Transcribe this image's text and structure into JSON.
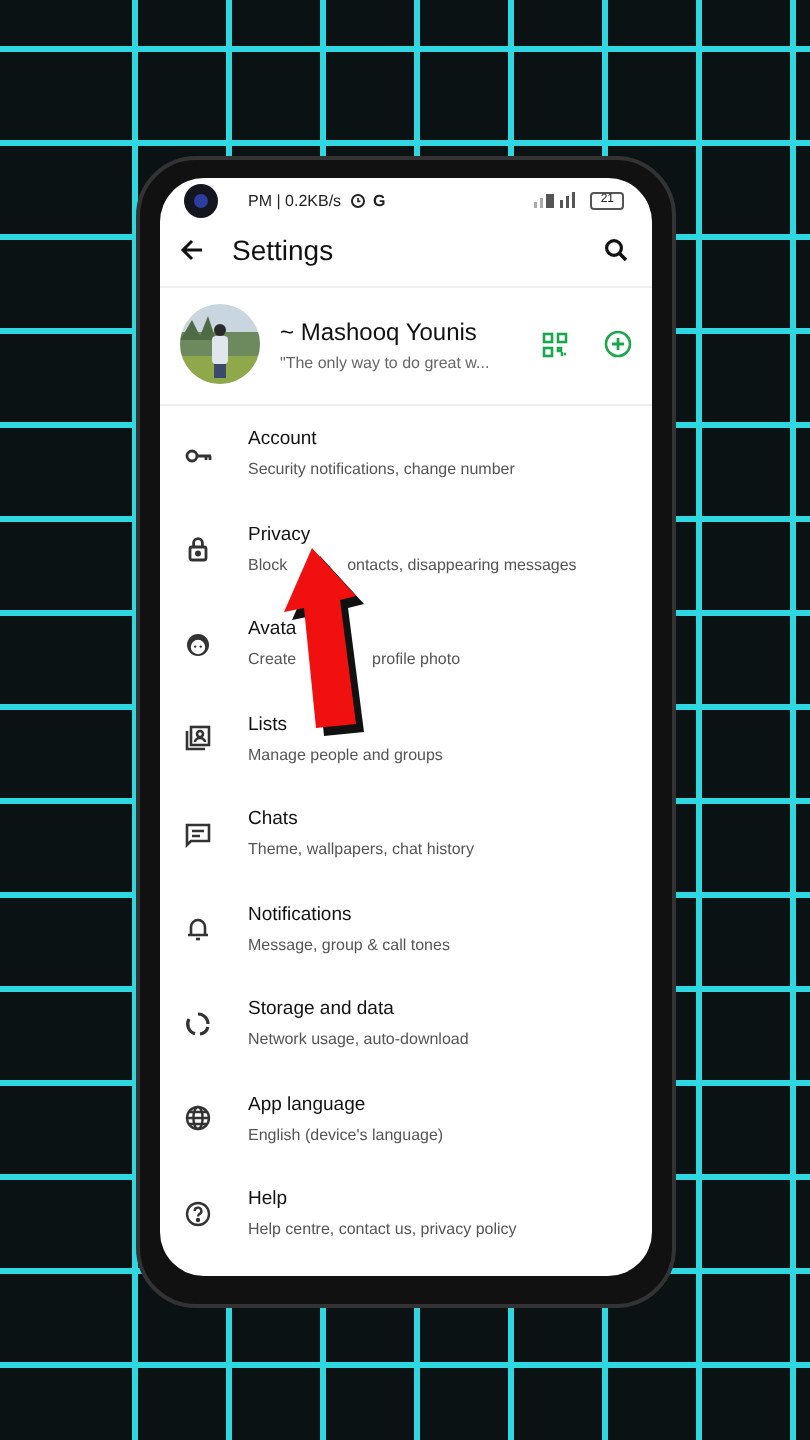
{
  "status_bar": {
    "time": "PM | 0.2KB/s",
    "network": "G",
    "battery": "21"
  },
  "header": {
    "title": "Settings"
  },
  "profile": {
    "name": "~ Mashooq Younis",
    "about": "\"The only way to do great w..."
  },
  "items": [
    {
      "kind": "key",
      "title": "Account",
      "subtitle": "Security notifications, change number"
    },
    {
      "kind": "lock",
      "title": "Privacy",
      "subtitle": "Block",
      "subtitle_rest": "ontacts, disappearing messages"
    },
    {
      "kind": "avatar",
      "title": "Avata",
      "subtitle": "Create",
      "subtitle_rest": "profile photo"
    },
    {
      "kind": "lists",
      "title": "Lists",
      "subtitle": "Manage people and groups"
    },
    {
      "kind": "chats",
      "title": "Chats",
      "subtitle": "Theme, wallpapers, chat history"
    },
    {
      "kind": "bell",
      "title": "Notifications",
      "subtitle": "Message, group & call tones"
    },
    {
      "kind": "storage",
      "title": "Storage and data",
      "subtitle": "Network usage, auto-download"
    },
    {
      "kind": "globe",
      "title": "App language",
      "subtitle": "English (device's language)"
    },
    {
      "kind": "help",
      "title": "Help",
      "subtitle": "Help centre, contact us, privacy policy"
    }
  ]
}
